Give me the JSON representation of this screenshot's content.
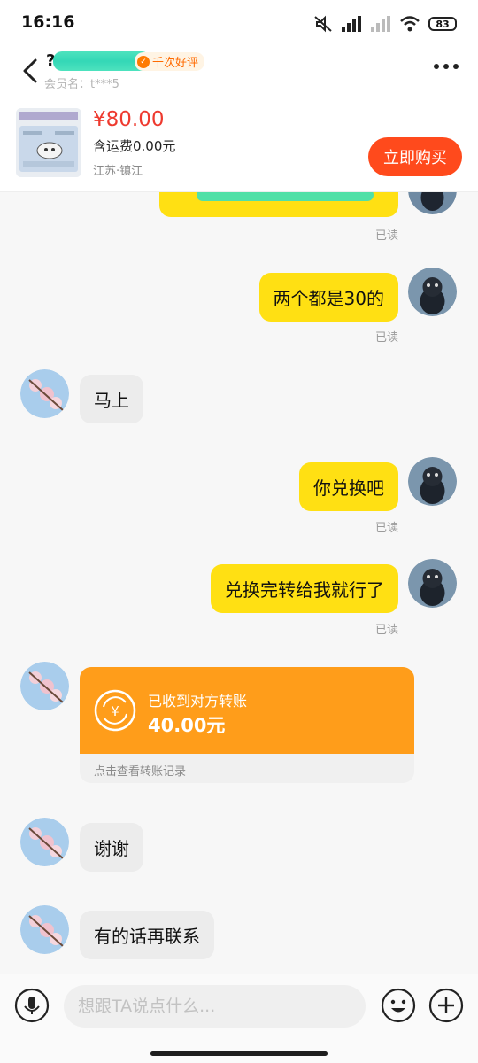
{
  "status_bar": {
    "time": "16:16",
    "battery": "83",
    "icons": [
      "mute-icon",
      "signal-icon",
      "signal-weak-icon",
      "wifi-icon",
      "battery-icon"
    ]
  },
  "header": {
    "seller_name": "?",
    "rating_badge": "千次好评",
    "member_label": "会员名：t***5"
  },
  "product": {
    "price": "¥80.00",
    "shipping": "含运费0.00元",
    "location": "江苏·镇江",
    "buy_label": "立即购买"
  },
  "messages": [
    {
      "side": "me",
      "text": "两个都是30的",
      "read": "已读"
    },
    {
      "side": "other",
      "text": "马上"
    },
    {
      "side": "me",
      "text": "你兑换吧",
      "read": "已读"
    },
    {
      "side": "me",
      "text": "兑换完转给我就行了",
      "read": "已读"
    },
    {
      "side": "other",
      "text": "谢谢"
    },
    {
      "side": "other",
      "text": "有的话再联系"
    }
  ],
  "first_read": "已读",
  "transfer": {
    "status": "已收到对方转账",
    "amount": "40.00元",
    "link": "点击查看转账记录"
  },
  "input": {
    "placeholder": "想跟TA说点什么..."
  },
  "colors": {
    "my_bubble": "#ffe013",
    "other_bubble": "#ececec",
    "transfer": "#ff9d1a",
    "buy_button": "#ff4a1c",
    "price": "#ee3a2f"
  }
}
